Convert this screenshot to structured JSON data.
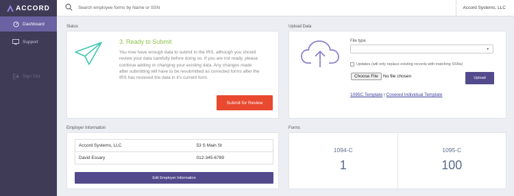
{
  "app": {
    "brand": "ACCORD",
    "accent_color": "#6a62a3",
    "sidebar_color": "#3f3a56"
  },
  "sidebar": {
    "items": [
      {
        "label": "Dashboard",
        "icon": "dashboard-icon",
        "active": true
      },
      {
        "label": "Support",
        "icon": "support-icon",
        "active": false
      },
      {
        "label": "Sign Out",
        "icon": "sign-out-icon",
        "active": false
      }
    ]
  },
  "topbar": {
    "search_placeholder": "Search employee forms by Name or SSN",
    "company_name": "Accord Systems, LLC"
  },
  "status": {
    "section_title": "Status",
    "heading": "3. Ready to Submit",
    "body": "You now have enough data to submit to the IRS, although you should review your data carefully before doing so. If you are not ready, please continue adding or changing your existing data. Any changes made after submitting will have to be resubmitted as corrected forms after the IRS has recieved the data in it's current form.",
    "submit_label": "Submit for Review",
    "heading_color": "#8bc34a",
    "submit_color": "#e8492f"
  },
  "upload": {
    "section_title": "Upload Data",
    "file_type_label": "File type",
    "file_type_value": "",
    "updates_label": "Updates (will only replace existing records with matching SSNs)",
    "updates_checked": false,
    "choose_file_label": "Choose File",
    "no_file_text": "No file chosen",
    "upload_label": "Upload",
    "template_1095c": "1095C Template",
    "template_separator": "|",
    "template_covered": "Covered Individual Template"
  },
  "employer": {
    "section_title": "Employer Information",
    "rows": [
      [
        "Accord Systems, LLC",
        "53 S Main St"
      ],
      [
        "David Essary",
        "012-345-6789"
      ]
    ],
    "edit_label": "Edit Employer Information"
  },
  "forms": {
    "section_title": "Forms",
    "cards": [
      {
        "name": "1094-C",
        "count": "1"
      },
      {
        "name": "1095-C",
        "count": "100"
      }
    ]
  }
}
